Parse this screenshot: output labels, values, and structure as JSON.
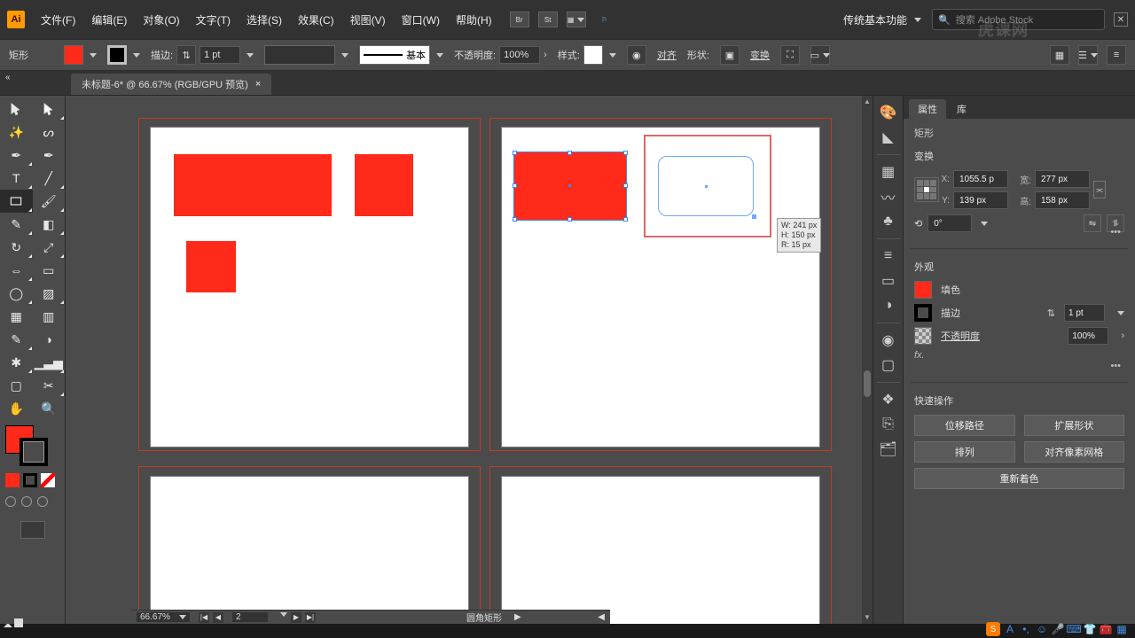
{
  "menu": {
    "file": "文件(F)",
    "edit": "编辑(E)",
    "object": "对象(O)",
    "type": "文字(T)",
    "select": "选择(S)",
    "effect": "效果(C)",
    "view": "视图(V)",
    "window": "窗口(W)",
    "help": "帮助(H)"
  },
  "titlebar": {
    "bridge": "Br",
    "stock": "St",
    "workspace": "传统基本功能",
    "search_placeholder": "搜索 Adobe Stock"
  },
  "options": {
    "object_name": "矩形",
    "stroke_label": "描边:",
    "stroke_weight": "1 pt",
    "brush_label": "基本",
    "opacity_label": "不透明度:",
    "opacity_value": "100%",
    "style_label": "样式:",
    "align_label": "对齐",
    "shape_label": "形状:",
    "transform_label": "变换"
  },
  "doc": {
    "tab_title": "未标题-6* @ 66.67% (RGB/GPU 预览)"
  },
  "status": {
    "zoom": "66.67%",
    "artboard_index": "2",
    "tool_name": "圆角矩形"
  },
  "readout": {
    "w": "W: 241 px",
    "h": "H: 150 px",
    "r": "R: 15 px"
  },
  "props": {
    "tab_properties": "属性",
    "tab_libraries": "库",
    "object_kind": "矩形",
    "section_transform": "变换",
    "x_label": "X:",
    "y_label": "Y:",
    "w_label": "宽:",
    "h_label": "高:",
    "x_value": "1055.5 p",
    "y_value": "139 px",
    "w_value": "277 px",
    "h_value": "158 px",
    "rotate_value": "0°",
    "section_appearance": "外观",
    "fill_label": "填色",
    "stroke_label": "描边",
    "stroke_value": "1 pt",
    "opacity_label": "不透明度",
    "opacity_value": "100%",
    "fx_label": "fx.",
    "section_quick": "快速操作",
    "btn_offset": "位移路径",
    "btn_expand": "扩展形状",
    "btn_arrange": "排列",
    "btn_pixelgrid": "对齐像素网格",
    "btn_recolor": "重新着色"
  },
  "watermark": "虎课网"
}
